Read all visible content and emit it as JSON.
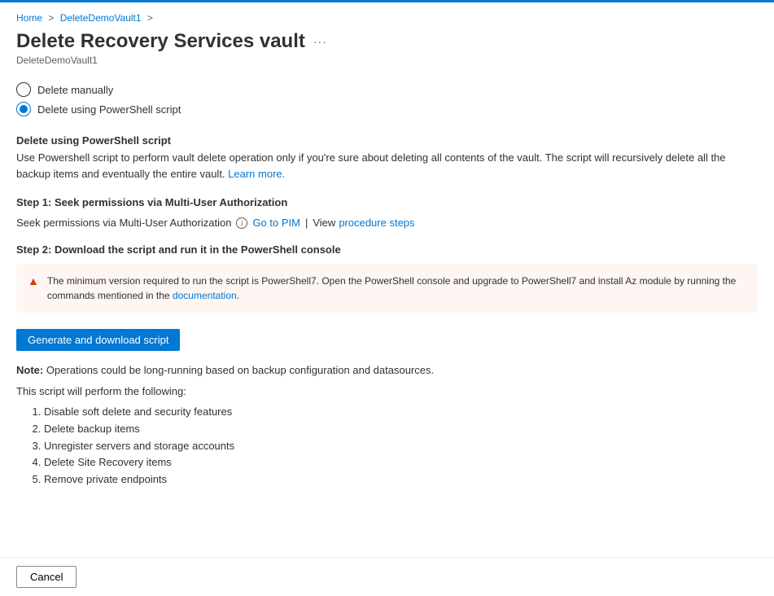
{
  "breadcrumb": {
    "home": "Home",
    "vault": "DeleteDemoVault1"
  },
  "header": {
    "title": "Delete Recovery Services vault",
    "subtitle": "DeleteDemoVault1"
  },
  "radios": {
    "manual": "Delete manually",
    "script": "Delete using PowerShell script"
  },
  "scriptSection": {
    "heading": "Delete using PowerShell script",
    "desc_part1": "Use Powershell script to perform vault delete operation only if you're sure about deleting all contents of the vault. The script will recursively delete all the backup items and eventually the entire vault. ",
    "learnMore": "Learn more."
  },
  "step1": {
    "heading": "Step 1: Seek permissions via Multi-User Authorization",
    "label": "Seek permissions via Multi-User Authorization",
    "gotoPim": "Go to PIM",
    "viewWord": "View",
    "procedureSteps": "procedure steps"
  },
  "step2": {
    "heading": "Step 2: Download the script and run it in the PowerShell console"
  },
  "warning": {
    "text_part1": "The minimum version required to run the script is PowerShell7. Open the PowerShell console and upgrade to PowerShell7 and install Az module by running the commands mentioned in the ",
    "docLink": "documentation",
    "period": "."
  },
  "buttons": {
    "generate": "Generate and download script",
    "cancel": "Cancel"
  },
  "note": {
    "label": "Note:",
    "text": " Operations could be long-running based on backup configuration and datasources.",
    "followingText": "This script will perform the following:",
    "items": [
      "Disable soft delete and security features",
      "Delete backup items",
      "Unregister servers and storage accounts",
      "Delete Site Recovery items",
      "Remove private endpoints"
    ]
  }
}
